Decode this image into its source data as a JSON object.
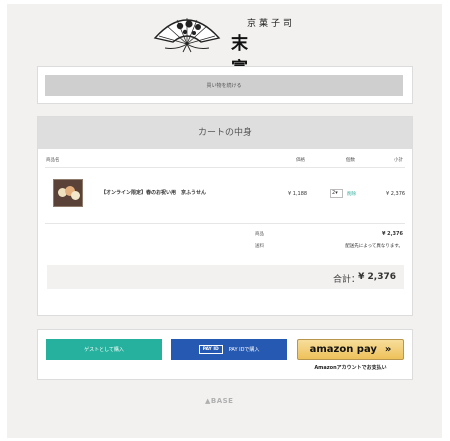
{
  "brand": {
    "kanji_sub": "京菓子司",
    "kanji_main": "末富"
  },
  "continue_shopping": {
    "label": "買い物を続ける"
  },
  "cart": {
    "title": "カートの中身",
    "columns": {
      "product": "商品名",
      "price": "価格",
      "quantity": "個数",
      "subtotal": "小計"
    },
    "items": [
      {
        "name": "【オンライン限定】春のお祝い用　京ふうせん",
        "price": "¥ 1,188",
        "quantity": "2",
        "delete_label": "削除",
        "subtotal": "¥ 2,376"
      }
    ],
    "summary": {
      "goods_label": "商品",
      "goods_value": "¥ 2,376",
      "shipping_label": "送料",
      "shipping_value": "配送先によって異なります。"
    },
    "total": {
      "label": "合計：",
      "value": "¥ 2,376"
    }
  },
  "checkout": {
    "guest_label": "ゲストとして購入",
    "payid_badge": "PAY ID",
    "payid_label": "PAY IDで購入",
    "amazon_label": "amazon pay",
    "amazon_arrow": "»",
    "amazon_note": "Amazonアカウントでお支払い"
  },
  "footer": {
    "powered_by": "BASE"
  },
  "colors": {
    "guest": "#25b19d",
    "payid": "#2659b1",
    "amazon": "#f3cf76",
    "page_bg": "#f2f1ef"
  }
}
